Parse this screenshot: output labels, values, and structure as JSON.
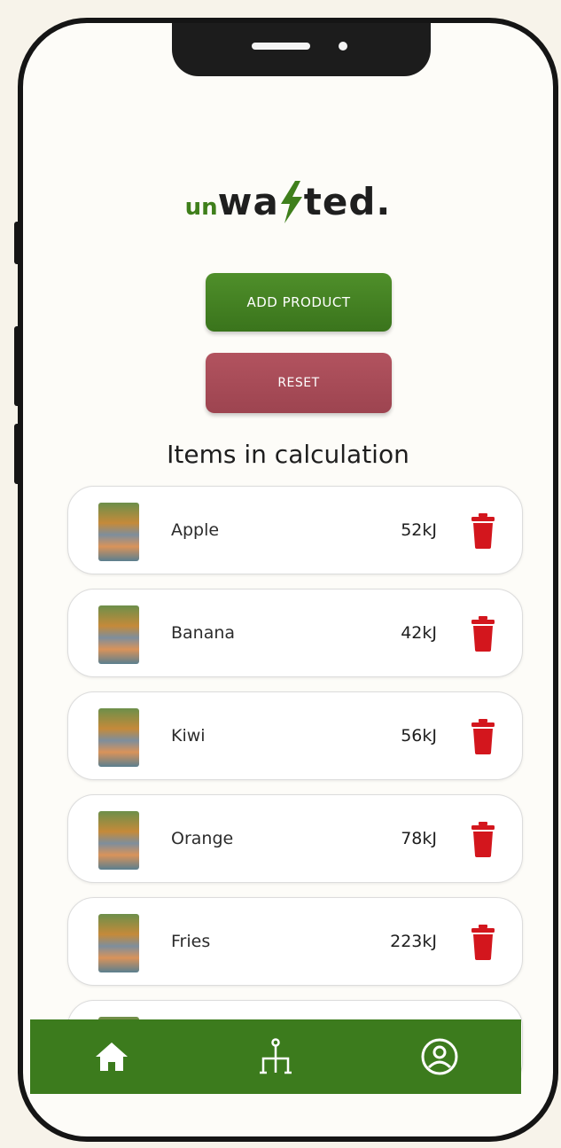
{
  "logo": {
    "un": "un",
    "wa": "wa",
    "ted": "ted."
  },
  "buttons": {
    "add_product": "ADD PRODUCT",
    "reset": "RESET"
  },
  "section_title": "Items in calculation",
  "items": [
    {
      "name": "Apple",
      "energy": "52kJ"
    },
    {
      "name": "Banana",
      "energy": "42kJ"
    },
    {
      "name": "Kiwi",
      "energy": "56kJ"
    },
    {
      "name": "Orange",
      "energy": "78kJ"
    },
    {
      "name": "Fries",
      "energy": "223kJ"
    },
    {
      "name": "",
      "energy": ""
    }
  ],
  "nav": {
    "home_icon": "home-icon",
    "scale_icon": "scale-icon",
    "profile_icon": "profile-icon"
  },
  "colors": {
    "brand_green": "#3c7b1d",
    "reset_red": "#a84a56",
    "trash_red": "#d3161d"
  }
}
